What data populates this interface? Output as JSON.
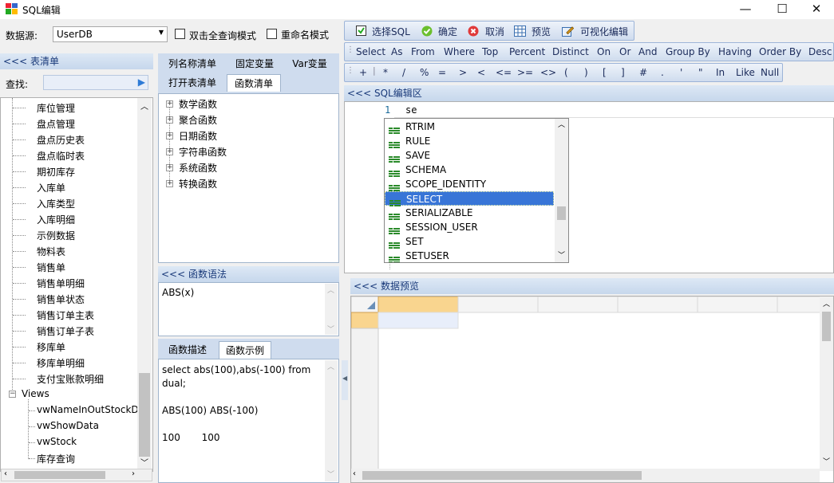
{
  "window": {
    "title": "SQL编辑",
    "minimize": "—",
    "maximize": "☐",
    "close": "✕"
  },
  "datasource": {
    "label": "数据源:",
    "value": "UserDB"
  },
  "options": {
    "dblclick_query": "双击全查询模式",
    "rename_mode": "重命名模式"
  },
  "table_list": {
    "header": "<<< 表清单",
    "search_label": "查找:",
    "search_value": ""
  },
  "tree": {
    "tables": [
      "库位管理",
      "盘点管理",
      "盘点历史表",
      "盘点临时表",
      "期初库存",
      "入库单",
      "入库类型",
      "入库明细",
      "示例数据",
      "物料表",
      "销售单",
      "销售单明细",
      "销售单状态",
      "销售订单主表",
      "销售订单子表",
      "移库单",
      "移库单明细",
      "支付宝账款明细"
    ],
    "views_label": "Views",
    "views": [
      "vwNameInOutStockDt",
      "vwShowData",
      "vwStock",
      "库存查询"
    ]
  },
  "mid_tabs": {
    "row1": [
      "列名称清单",
      "固定变量",
      "Var变量"
    ],
    "row2": [
      "打开表清单",
      "函数清单"
    ]
  },
  "func_tree": [
    "数学函数",
    "聚合函数",
    "日期函数",
    "字符串函数",
    "系统函数",
    "转换函数"
  ],
  "func_syntax": {
    "header": "<<< 函数语法",
    "text": "ABS(x)"
  },
  "func_tabs": [
    "函数描述",
    "函数示例"
  ],
  "func_example": {
    "line1": "select abs(100),abs(-100) from",
    "line2": "dual;",
    "line3": "ABS(100) ABS(-100)",
    "line4": "100       100"
  },
  "toolbar1": [
    "选择SQL",
    "确定",
    "取消",
    "预览",
    "可视化编辑"
  ],
  "toolbar2": [
    "Select",
    "As",
    "From",
    "Where",
    "Top",
    "Percent",
    "Distinct",
    "On",
    "Or",
    "And",
    "Group By",
    "Having",
    "Order By",
    "Desc"
  ],
  "toolbar3": [
    "+",
    "*",
    "/",
    "%",
    "=",
    ">",
    "<",
    "<=",
    ">=",
    "<>",
    "(",
    ")",
    "[",
    "]",
    "#",
    ".",
    "'",
    "\"",
    "In",
    "Like",
    "Null"
  ],
  "sql_editor": {
    "header": "<<< SQL编辑区",
    "line_no": "1",
    "text": "se"
  },
  "autocomplete": [
    "RTRIM",
    "RULE",
    "SAVE",
    "SCHEMA",
    "SCOPE_IDENTITY",
    "SELECT",
    "SERIALIZABLE",
    "SESSION_USER",
    "SET",
    "SETUSER"
  ],
  "autocomplete_selected": "SELECT",
  "preview": {
    "header": "<<< 数据预览"
  },
  "colors": {
    "accent": "#3875d7",
    "header_bg": "#c6d7ec",
    "grid_cell": "#fbd9a4"
  }
}
